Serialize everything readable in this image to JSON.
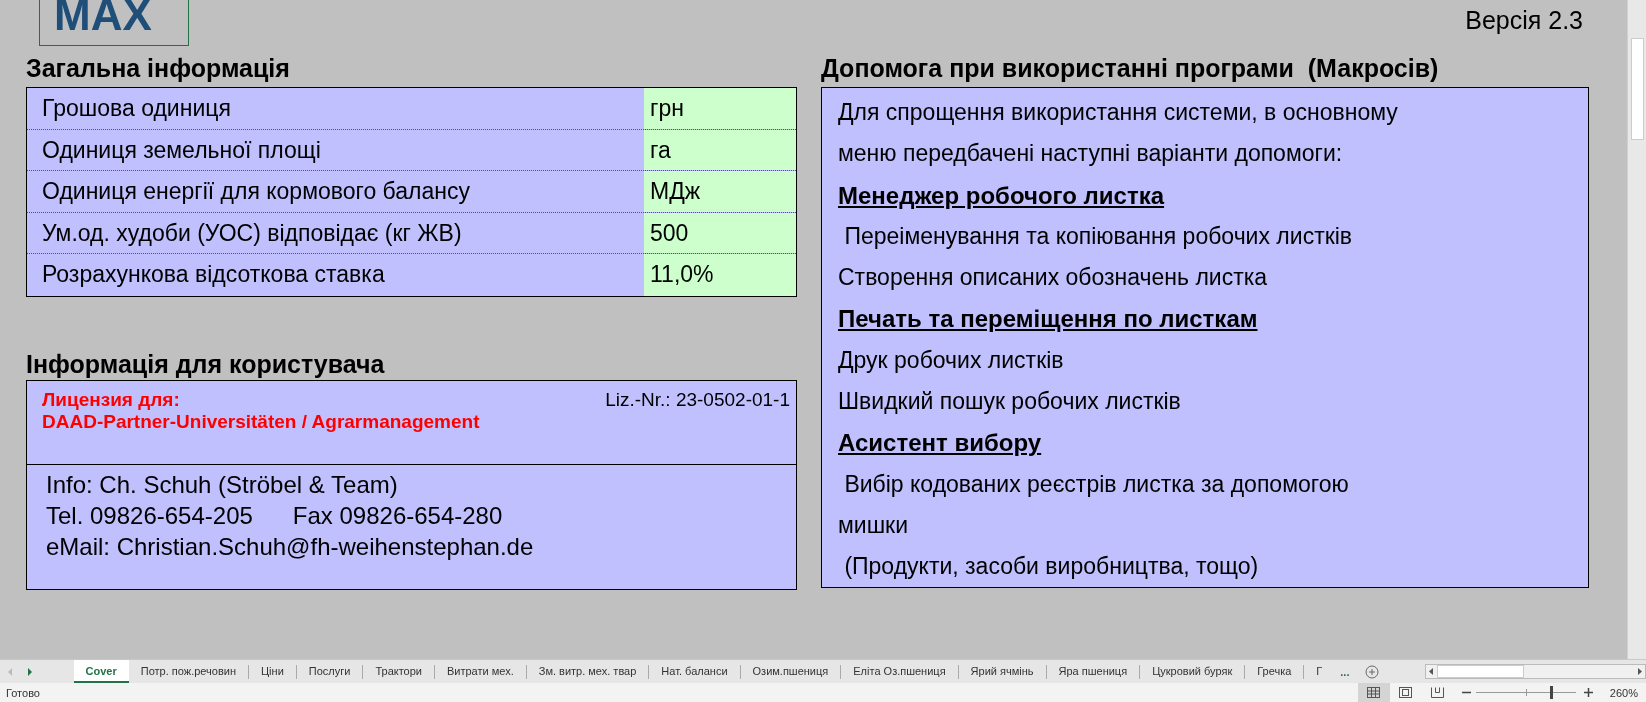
{
  "logo": {
    "text": "MAX"
  },
  "version": "Версія 2.3",
  "general": {
    "title": "Загальна інформація",
    "rows": [
      {
        "label": "Грошова одиниця",
        "value": "грн"
      },
      {
        "label": "Одиниця земельної площі",
        "value": "га"
      },
      {
        "label": "Одиниця енергії для кормового балансу",
        "value": "МДж"
      },
      {
        "label": "Ум.од. худоби (УОС) відповідає (кг ЖВ)",
        "value": "500"
      },
      {
        "label": "Розрахункова відсоткова ставка",
        "value": "11,0%"
      }
    ]
  },
  "user_info": {
    "title": "Інформація для користувача",
    "license_label": "Лицензия для:",
    "license_no": "Liz.-Nr.: 23-0502-01-1",
    "licensee": "DAAD-Partner-Universitäten / Agrarmanagement",
    "contact": [
      "Info: Ch. Schuh (Ströbel & Team)",
      "Tel. 09826-654-205      Fax 09826-654-280",
      "eMail: Christian.Schuh@fh-weihenstephan.de"
    ]
  },
  "help": {
    "title": "Допомога при використанні програми  (Макросів)",
    "lines": [
      {
        "kind": "text",
        "text": "Для спрощення використання системи, в основному"
      },
      {
        "kind": "text",
        "text": "меню передбачені наступні варіанти допомоги:"
      },
      {
        "kind": "heading",
        "text": "Менеджер робочого листка"
      },
      {
        "kind": "text",
        "text": " Переіменування та копіювання робочих листків"
      },
      {
        "kind": "text",
        "text": "Створення описаних обозначень листка"
      },
      {
        "kind": "heading",
        "text": "Печать та переміщення по листкам"
      },
      {
        "kind": "text",
        "text": "Друк робочих листків"
      },
      {
        "kind": "text",
        "text": "Швидкий пошук робочих листків"
      },
      {
        "kind": "heading",
        "text": "Асистент вибору"
      },
      {
        "kind": "text",
        "text": " Вибір кодованих реєстрів листка за допомогою"
      },
      {
        "kind": "text",
        "text": "мишки"
      },
      {
        "kind": "text",
        "text": " (Продукти, засоби виробництва, тощо)"
      }
    ]
  },
  "sheet_tabs": [
    {
      "label": "Cover",
      "selected": true
    },
    {
      "label": "Потр. пож.речовин",
      "selected": false
    },
    {
      "label": "Ціни",
      "selected": false
    },
    {
      "label": "Послуги",
      "selected": false
    },
    {
      "label": "Трактори",
      "selected": false
    },
    {
      "label": "Витрати мех.",
      "selected": false
    },
    {
      "label": "Зм. витр. мех. твар",
      "selected": false
    },
    {
      "label": "Нат. баланси",
      "selected": false
    },
    {
      "label": "Озим.пшениця",
      "selected": false
    },
    {
      "label": "Еліта Оз.пшениця",
      "selected": false
    },
    {
      "label": "Ярий ячмінь",
      "selected": false
    },
    {
      "label": "Яра пшениця",
      "selected": false
    },
    {
      "label": "Цукровий буряк",
      "selected": false
    },
    {
      "label": "Гречка",
      "selected": false
    },
    {
      "label": "Г",
      "selected": false
    }
  ],
  "tab_overflow": "...",
  "status_bar": {
    "status": "Готово",
    "zoom": {
      "level": 0.75,
      "reading": "260%"
    }
  }
}
